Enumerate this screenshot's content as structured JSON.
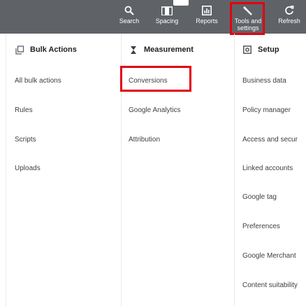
{
  "toolbar": {
    "search_label": "Search",
    "spacing_label": "Spacing",
    "reports_label": "Reports",
    "tools_label_line1": "Tools and",
    "tools_label_line2": "settings",
    "refresh_label": "Refresh",
    "icons": [
      "search-icon",
      "spacing-icon",
      "reports-icon",
      "wrench-icon",
      "refresh-icon"
    ]
  },
  "columns": [
    {
      "header": "Bulk Actions",
      "icon": "bulk-actions-icon",
      "items": [
        "All bulk actions",
        "Rules",
        "Scripts",
        "Uploads"
      ]
    },
    {
      "header": "Measurement",
      "icon": "hourglass-icon",
      "items": [
        "Conversions",
        "Google Analytics",
        "Attribution"
      ]
    },
    {
      "header": "Setup",
      "icon": "setup-icon",
      "items": [
        "Business data",
        "Policy manager",
        "Access and secur",
        "Linked accounts",
        "Google tag",
        "Preferences",
        "Google Merchant",
        "Content suitability"
      ]
    }
  ],
  "colors": {
    "toolbar_bg": "#5f6368",
    "highlight": "#e3000f",
    "text": "#3c4043"
  }
}
